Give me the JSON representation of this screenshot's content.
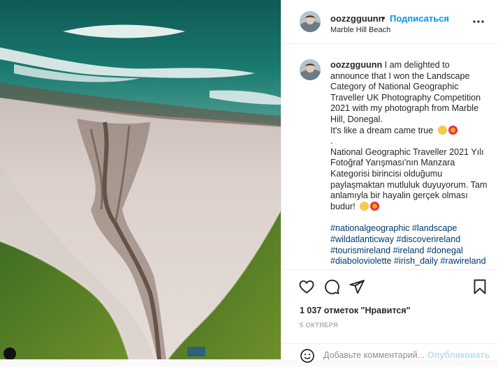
{
  "colors": {
    "link": "#0095f6",
    "hashtag": "#00376b",
    "muted": "#8e8e8e",
    "publish_disabled": "#b2dffc"
  },
  "post": {
    "photo_alt": "aerial beach photo",
    "user": "oozzgguunn",
    "separator": "•",
    "follow_label": "Подписаться",
    "location": "Marble Hill Beach",
    "more_icon": "more-horizontal-icon",
    "caption": {
      "user": "oozzgguunn",
      "text_en": "I am delighted to announce that I won the Landscape Category of National Geographic Traveller UK Photography Competition 2021 with my photograph from Marble Hill, Donegal.",
      "text_en_2": "It's like a dream came true",
      "dot": ".",
      "text_tr": "National Geographic Traveller 2021 Yılı Fotoğraf Yarışması'nın Manzara Kategorisi birincisi olduğumu paylaşmaktan mutluluk duyuyorum. Tam anlamıyla bir hayalin gerçek olması budur!",
      "emojis": [
        "face-with-party-hat-emoji",
        "smiling-face-with-heart-eyes-emoji"
      ],
      "hashtags": [
        "#nationalgeographic",
        "#landscape",
        "#wildatlanticway",
        "#discoverireland",
        "#tourismireland",
        "#ireland",
        "#donegal",
        "#diaboloviolette",
        "#irish_daily",
        "#rawireland"
      ]
    },
    "actions": {
      "like_icon": "heart-icon",
      "comment_icon": "comment-icon",
      "share_icon": "send-icon",
      "save_icon": "bookmark-icon"
    },
    "likes": "1 037 отметок \"Нравится\"",
    "date": "5 ОКТЯБРЯ",
    "comment_box": {
      "emoji_icon": "smiley-icon",
      "placeholder": "Добавьте комментарий...",
      "publish_label": "Опубликовать"
    }
  }
}
